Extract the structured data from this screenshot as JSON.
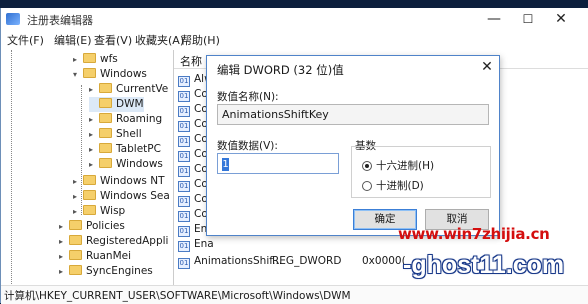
{
  "window": {
    "title": "注册表编辑器",
    "min_glyph": "—",
    "max_glyph": "☐",
    "close_glyph": "✕"
  },
  "menu": [
    "文件(F)",
    "编辑(E)",
    "查看(V)",
    "收藏夹(A)",
    "帮助(H)"
  ],
  "tree": [
    {
      "label": "wfs",
      "expanded": false
    },
    {
      "label": "Windows",
      "expanded": true
    },
    {
      "label": "CurrentVe",
      "expanded": false
    },
    {
      "label": "DWM",
      "selected": true
    },
    {
      "label": "Roaming",
      "expanded": false
    },
    {
      "label": "Shell",
      "expanded": false
    },
    {
      "label": "TabletPC",
      "expanded": false
    },
    {
      "label": "Windows",
      "expanded": false
    },
    {
      "label": "Windows NT",
      "expanded": false
    },
    {
      "label": "Windows Sea",
      "expanded": false
    },
    {
      "label": "Wisp",
      "expanded": false
    },
    {
      "label": "Policies",
      "expanded": false
    },
    {
      "label": "RegisteredAppli",
      "expanded": false
    },
    {
      "label": "RuanMei",
      "expanded": false
    },
    {
      "label": "SyncEngines",
      "expanded": false
    }
  ],
  "values_pane": {
    "column_name": "名称",
    "rows": [
      {
        "name": "Alw",
        "type": "",
        "data": ""
      },
      {
        "name": "Col",
        "type": "",
        "data": ""
      },
      {
        "name": "Col",
        "type": "",
        "data": ""
      },
      {
        "name": "Col",
        "type": "",
        "data": ""
      },
      {
        "name": "Col",
        "type": "",
        "data": ""
      },
      {
        "name": "Col",
        "type": "",
        "data": ""
      },
      {
        "name": "Col",
        "type": "",
        "data": ""
      },
      {
        "name": "Col",
        "type": "",
        "data": ""
      },
      {
        "name": "Col",
        "type": "",
        "data": ""
      },
      {
        "name": "Cor",
        "type": "",
        "data": ""
      },
      {
        "name": "Ena",
        "type": "",
        "data": ""
      },
      {
        "name": "Ena",
        "type": "",
        "data": ""
      },
      {
        "name": "AnimationsShif...",
        "type": "REG_DWORD",
        "data": "0x0000("
      }
    ]
  },
  "status": "计算机\\HKEY_CURRENT_USER\\SOFTWARE\\Microsoft\\Windows\\DWM",
  "dialog": {
    "title": "编辑 DWORD (32 位)值",
    "close_glyph": "✕",
    "name_label": "数值名称(N):",
    "name_value": "AnimationsShiftKey",
    "data_label": "数值数据(V):",
    "data_value": "1",
    "base_label": "基数",
    "radio_hex": "十六进制(H)",
    "radio_dec": "十进制(D)",
    "selected_base": "hex",
    "ok_label": "确定",
    "cancel_label": "取消"
  },
  "watermark": {
    "line1": "www.win7zhijia.cn",
    "line2": "-ghost11.com"
  }
}
